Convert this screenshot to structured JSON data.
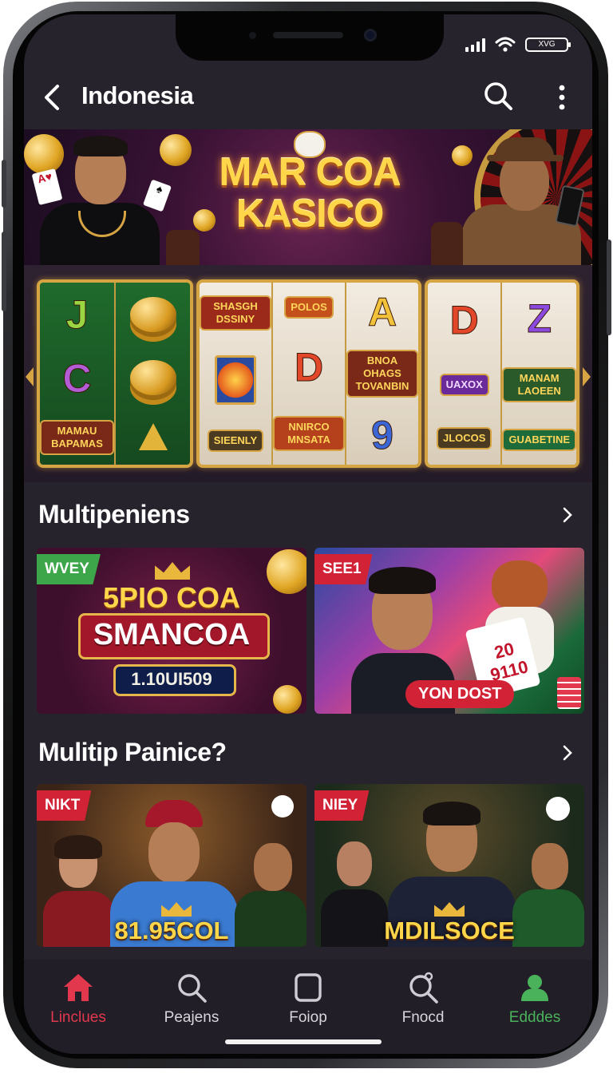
{
  "status": {
    "battery_text": "XVG"
  },
  "header": {
    "title": "Indonesia"
  },
  "hero": {
    "logo_line1": "MAR COA",
    "logo_line2": "KASICO"
  },
  "slots": {
    "reelset1": {
      "reel1": [
        "J",
        "C",
        "MAMAU BAPAMAS"
      ],
      "reel2": []
    },
    "reelset2": {
      "reel1": [
        "SHASGH DSSINY",
        "SIEENLY"
      ],
      "reel2": [
        "POLOS",
        "D",
        "NNIRCO MNSATA"
      ],
      "reel3": [
        "A",
        "BNOA OHAGS TOVANBIN",
        "9"
      ]
    },
    "reelset3": {
      "reel1": [
        "D",
        "UAXOX",
        "JLOCOS"
      ],
      "reel2": [
        "Z",
        "MANAM LAOEEN",
        "GUABETINE"
      ]
    }
  },
  "section1": {
    "title": "Multipeniens",
    "card1": {
      "tag": "WVEY",
      "line1": "5PIO COA",
      "line2": "SMANCOA",
      "amount": "1.10UI509"
    },
    "card2": {
      "tag": "SEE1",
      "card_text": "20 9110",
      "button": "YON DOST"
    }
  },
  "section2": {
    "title": "Mulitip Painice?",
    "card1": {
      "tag": "NIKT",
      "amount": "81.95COL"
    },
    "card2": {
      "tag": "NIEY",
      "amount": "MDILSOCE"
    }
  },
  "nav": {
    "items": [
      {
        "label": "Linclues",
        "icon": "home-icon",
        "color": "#e2384e"
      },
      {
        "label": "Peajens",
        "icon": "search-icon",
        "color": "#d8d6dc"
      },
      {
        "label": "Foiop",
        "icon": "square-icon",
        "color": "#d8d6dc"
      },
      {
        "label": "Fnocd",
        "icon": "search-badge-icon",
        "color": "#d8d6dc"
      },
      {
        "label": "Edddes",
        "icon": "profile-icon",
        "color": "#49b25a"
      }
    ]
  },
  "colors": {
    "background": "#27232d",
    "accent_red": "#e2384e",
    "accent_green": "#49b25a",
    "gold": "#ffd54a"
  }
}
